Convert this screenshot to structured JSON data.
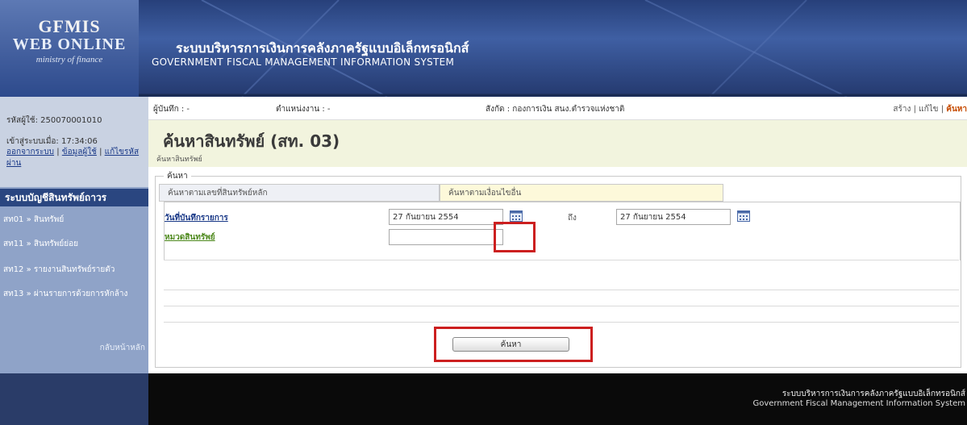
{
  "logo": {
    "title": "GFMIS",
    "subtitle": "WEB ONLINE",
    "tagline": "ministry of finance"
  },
  "banner": {
    "system_name_th": "ระบบบริหารการเงินการคลังภาครัฐแบบอิเล็กทรอนิกส์",
    "system_name_en": "GOVERNMENT FISCAL MANAGEMENT INFORMATION SYSTEM"
  },
  "sidebar": {
    "user_code": "รหัสผู้ใช้: 250070001010",
    "login_time": "เข้าสู่ระบบเมื่อ: 17:34:06",
    "links": {
      "logout": "ออกจากระบบ",
      "user_info": "ข้อมูลผู้ใช้",
      "change_password": "แก้ไขรหัสผ่าน",
      "sep1": "|",
      "sep2": "|"
    },
    "menu_header": "ระบบบัญชีสินทรัพย์ถาวร",
    "items": [
      {
        "label": "สท01 » สินทรัพย์"
      },
      {
        "label": "สท11 » สินทรัพย์ย่อย"
      },
      {
        "label": "สท12 » รายงานสินทรัพย์รายตัว"
      },
      {
        "label": "สท13 » ผ่านรายการด้วยการหักล้าง"
      }
    ],
    "home_link": "กลับหน้าหลัก"
  },
  "infobar": {
    "recorder": "ผู้บันทึก : -",
    "position": "ตำแหน่งงาน : -",
    "affiliation": "สังกัด : กองการเงิน สนง.ตำรวจแห่งชาติ",
    "actions": [
      "สร้าง",
      "แก้ไข",
      "ค้นหา"
    ],
    "action_sep": "|"
  },
  "page": {
    "title": "ค้นหาสินทรัพย์ (สท. 03)",
    "subtitle": "ค้นหาสินทรัพย์"
  },
  "search": {
    "legend": "ค้นหา",
    "tabs": [
      "ค้นหาตามเลขที่สินทรัพย์หลัก",
      "ค้นหาตามเงื่อนไขอื่น"
    ],
    "fields": {
      "record_date_label": "วันที่บันทึกรายการ",
      "date_from": "27 กันยายน 2554",
      "to_label": "ถึง",
      "date_to": "27 กันยายน 2554",
      "category_label": "หมวดสินทรัพย์",
      "category_value": ""
    },
    "button_label": "ค้นหา"
  },
  "footer": {
    "line1": "ระบบบริหารการเงินการคลังภาครัฐแบบอิเล็กทรอนิกส์",
    "line2": "Government Fiscal Management Information System"
  },
  "colors": {
    "banner": "#2e4a8a",
    "highlight": "#cc1f1f",
    "title_bg": "#f2f4de",
    "menu_header": "#2a4680"
  }
}
